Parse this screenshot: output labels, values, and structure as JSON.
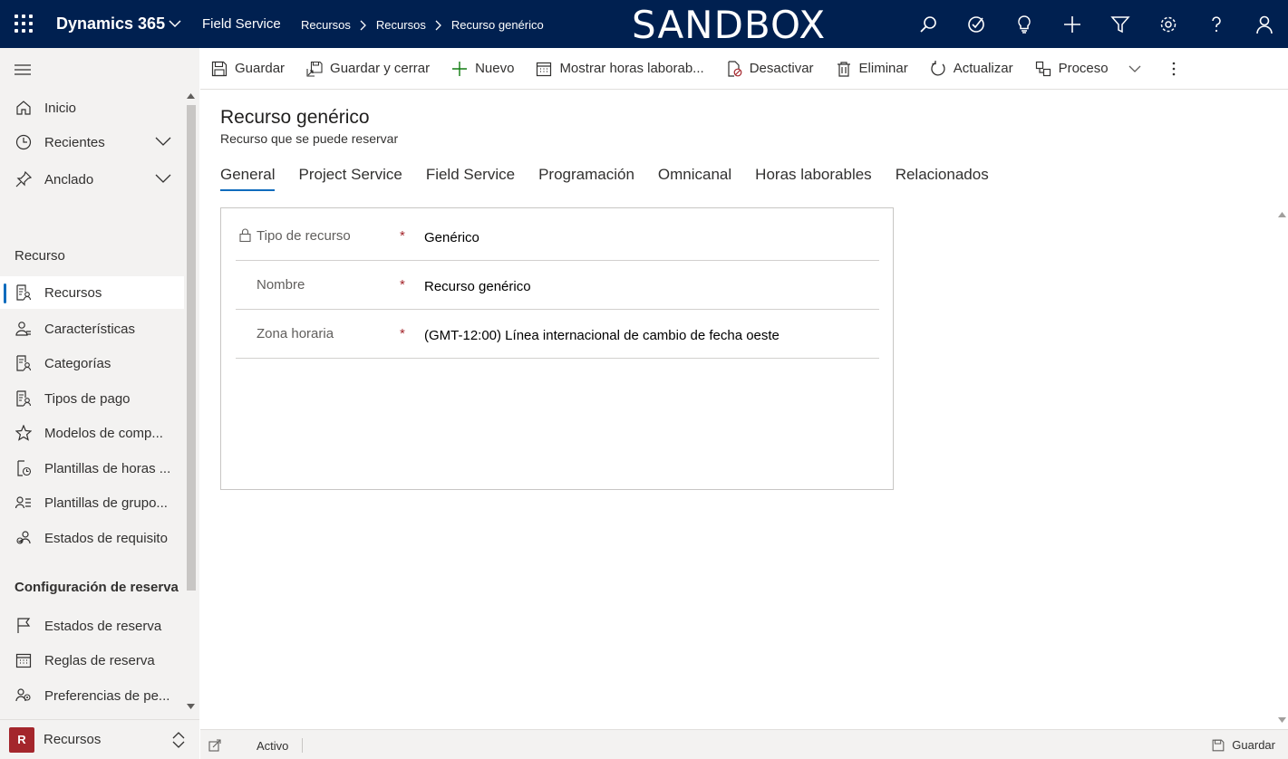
{
  "header": {
    "app_title": "Dynamics 365",
    "area_name": "Field Service",
    "breadcrumbs": [
      "Recursos",
      "Recursos",
      "Recurso genérico"
    ],
    "environment_banner": "SANDBOX",
    "icons": [
      "search-icon",
      "task-icon",
      "lightbulb-icon",
      "plus-icon",
      "filter-icon",
      "gear-icon",
      "help-icon",
      "user-icon"
    ]
  },
  "sidebar": {
    "top_items": [
      {
        "label": "Inicio",
        "icon": "home-icon"
      },
      {
        "label": "Recientes",
        "icon": "clock-icon"
      },
      {
        "label": "Anclado",
        "icon": "pin-icon"
      }
    ],
    "section1_title": "Recurso",
    "section1_items": [
      {
        "label": "Recursos",
        "icon": "resource-icon"
      },
      {
        "label": "Características",
        "icon": "characteristics-icon"
      },
      {
        "label": "Categorías",
        "icon": "category-icon"
      },
      {
        "label": "Tipos de pago",
        "icon": "pay-type-icon"
      },
      {
        "label": "Modelos de comp...",
        "icon": "star-icon"
      },
      {
        "label": "Plantillas de horas ...",
        "icon": "hours-template-icon"
      },
      {
        "label": "Plantillas de grupo...",
        "icon": "group-template-icon"
      },
      {
        "label": "Estados de requisito",
        "icon": "requirement-status-icon"
      }
    ],
    "section2_title": "Configuración de reserva",
    "section2_items": [
      {
        "label": "Estados de reserva",
        "icon": "flag-icon"
      },
      {
        "label": "Reglas de reserva",
        "icon": "calendar-icon"
      },
      {
        "label": "Preferencias de pe...",
        "icon": "preferences-icon"
      }
    ],
    "area_switcher": {
      "badge": "R",
      "label": "Recursos"
    }
  },
  "commandbar": {
    "items": [
      {
        "label": "Guardar",
        "icon": "save-icon"
      },
      {
        "label": "Guardar y cerrar",
        "icon": "save-close-icon"
      },
      {
        "label": "Nuevo",
        "icon": "plus-icon"
      },
      {
        "label": "Mostrar horas laborab...",
        "icon": "calendar-icon"
      },
      {
        "label": "Desactivar",
        "icon": "deactivate-icon"
      },
      {
        "label": "Eliminar",
        "icon": "trash-icon"
      },
      {
        "label": "Actualizar",
        "icon": "refresh-icon"
      },
      {
        "label": "Proceso",
        "icon": "process-icon"
      }
    ]
  },
  "record": {
    "title": "Recurso genérico",
    "subtitle": "Recurso que se puede reservar",
    "tabs": [
      "General",
      "Project Service",
      "Field Service",
      "Programación",
      "Omnicanal",
      "Horas laborables",
      "Relacionados"
    ],
    "active_tab": "General",
    "fields": [
      {
        "label": "Tipo de recurso",
        "required": "*",
        "value": "Genérico",
        "locked": true
      },
      {
        "label": "Nombre",
        "required": "*",
        "value": "Recurso genérico",
        "locked": false
      },
      {
        "label": "Zona horaria",
        "required": "*",
        "value": "(GMT-12:00) Línea internacional de cambio de fecha oeste",
        "locked": false
      }
    ]
  },
  "statusbar": {
    "status": "Activo",
    "save_label": "Guardar"
  },
  "colors": {
    "header_bg": "#002050",
    "accent": "#0f6cbd",
    "required": "#a4262c",
    "area_badge": "#a4262c"
  }
}
